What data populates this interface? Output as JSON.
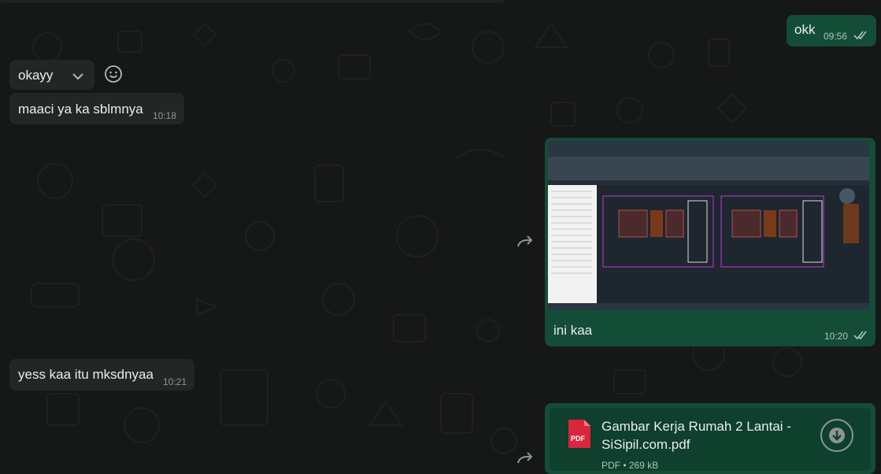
{
  "messages": {
    "m1": {
      "text": "okk",
      "time": "09:56"
    },
    "m2": {
      "text": "okayy"
    },
    "m3": {
      "text": "maaci ya ka sblmnya",
      "time": "10:18"
    },
    "m4": {
      "caption": "ini kaa",
      "time": "10:20"
    },
    "m5": {
      "text": "yess kaa itu mksdnyaa",
      "time": "10:21"
    },
    "m6": {
      "file_name_line1": "Gambar Kerja Rumah 2 Lantai -",
      "file_name_line2": "SiSipil.com.pdf",
      "file_meta": "PDF • 269 kB",
      "badge": "PDF"
    }
  },
  "icons": {
    "forward": "forward-icon",
    "emoji": "emoji-icon",
    "caret": "chevron-down-icon",
    "ticks": "double-check-icon",
    "download": "download-icon",
    "pdf": "pdf-file-icon"
  },
  "colors": {
    "background": "#161717",
    "incoming_bubble": "#242626",
    "outgoing_bubble": "#144d37",
    "pdf_red": "#d8263b"
  }
}
